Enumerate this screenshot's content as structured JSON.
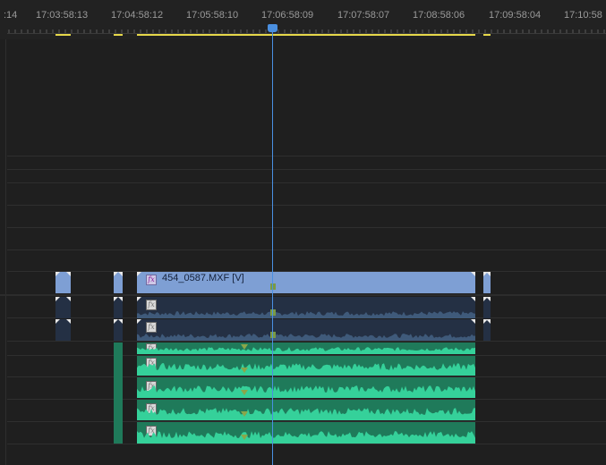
{
  "ruler": {
    "timecodes": [
      ":14",
      "17:03:58:13",
      "17:04:58:12",
      "17:05:58:10",
      "17:06:58:09",
      "17:07:58:07",
      "17:08:58:06",
      "17:09:58:04",
      "17:10:58"
    ]
  },
  "video_clip": {
    "name": "454_0587.MXF [V]",
    "fx_label": "fx"
  },
  "audio_clip": {
    "fx_label": "fx"
  },
  "colors": {
    "video_clip": "#7e9fd4",
    "audio_clip_dark": "#243044",
    "audio_clip_green": "#1f7a5a",
    "waveform_green": "#35d19a",
    "playhead": "#4a90e2",
    "in_out_bar": "#e6d84a",
    "keyframe": "#7a9a44"
  }
}
